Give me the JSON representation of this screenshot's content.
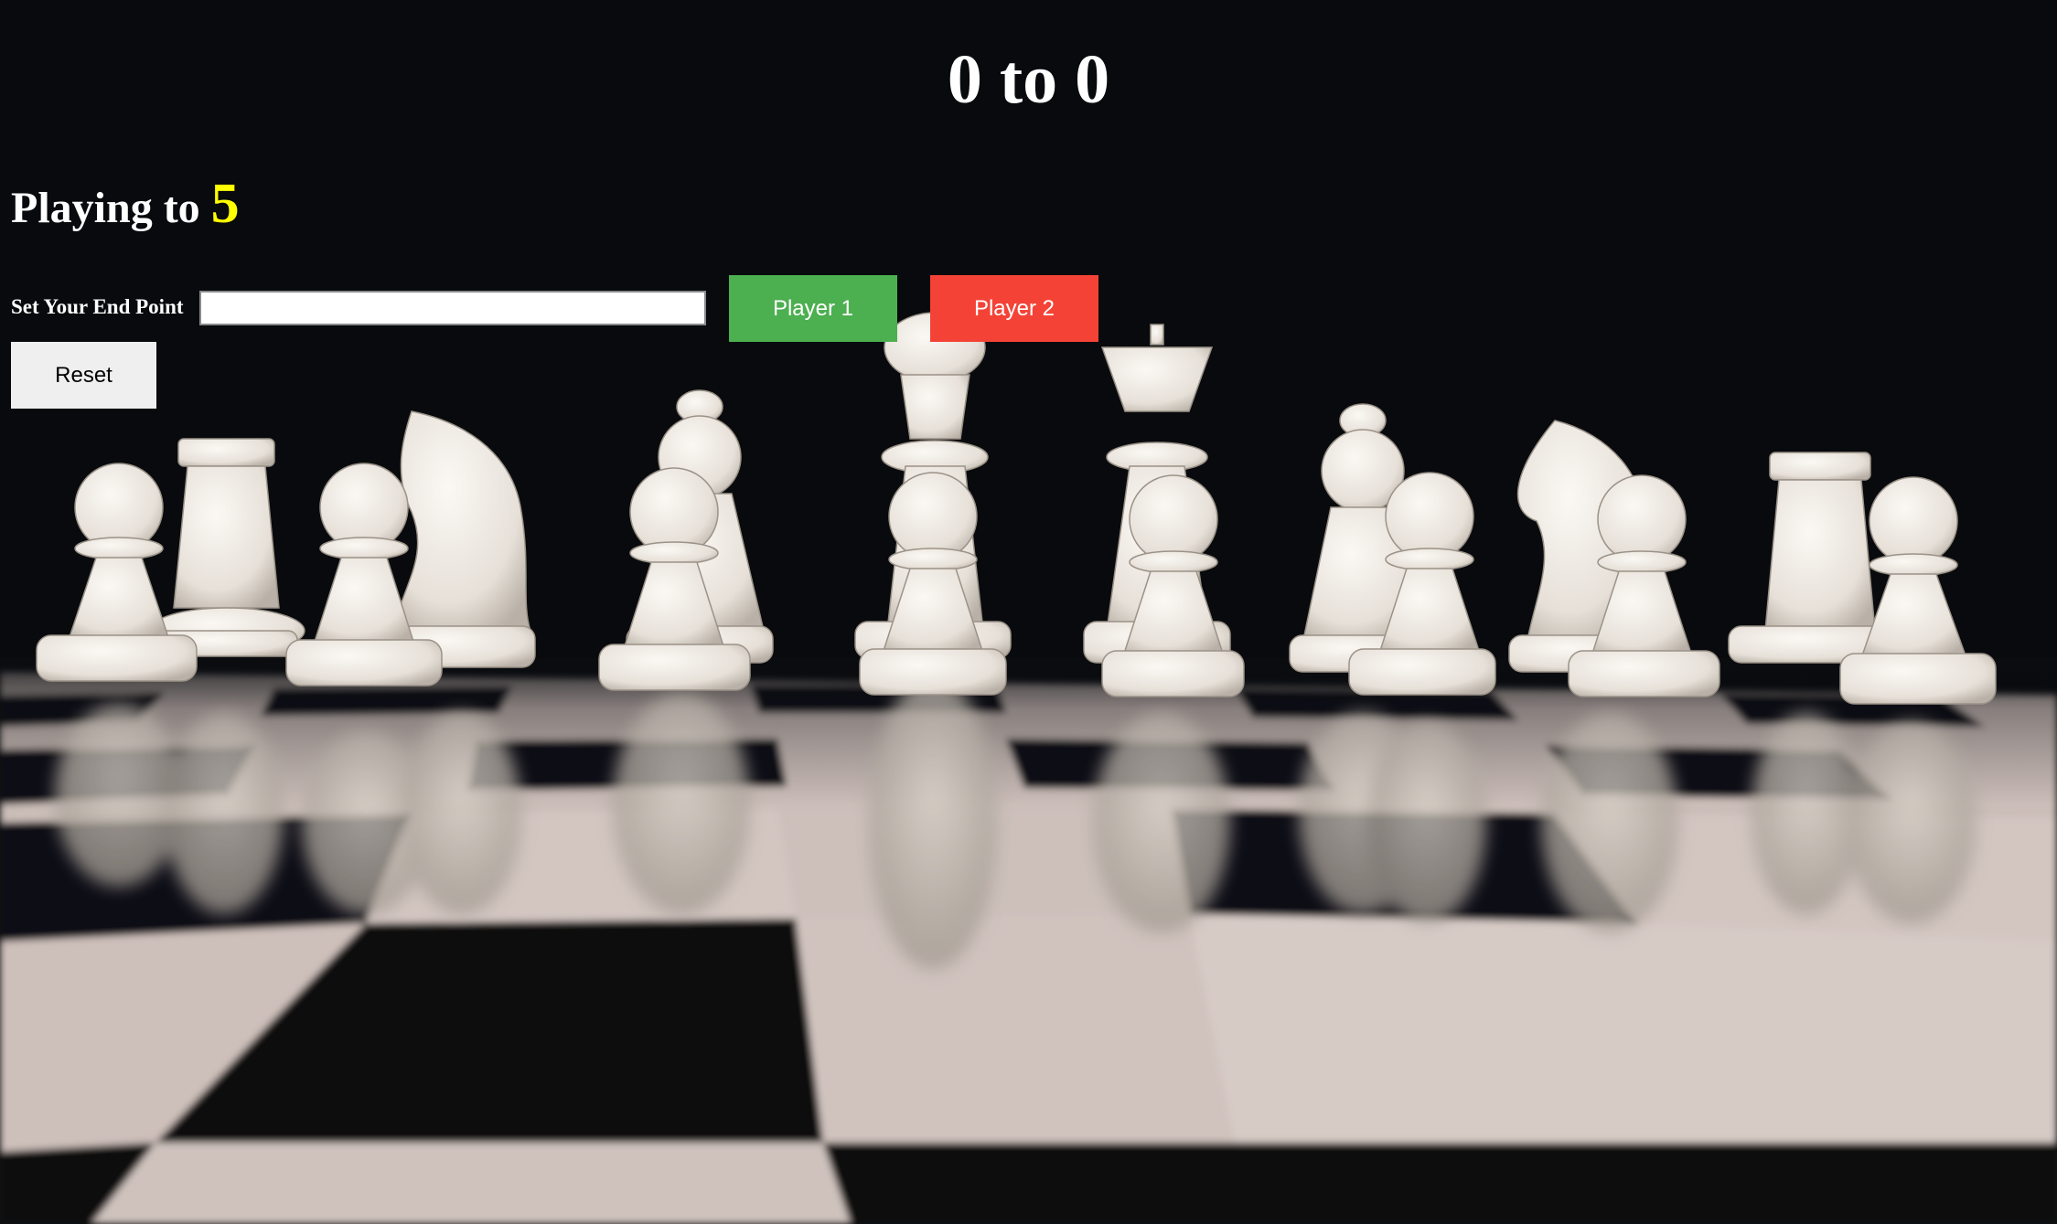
{
  "scoreboard": {
    "player1_score": "0",
    "separator": "to",
    "player2_score": "0"
  },
  "playing_to": {
    "label": "Playing to",
    "value": "5",
    "value_color": "#ffff00"
  },
  "controls": {
    "end_point_label": "Set Your End Point",
    "end_point_value": "",
    "player1_label": "Player 1",
    "player1_color": "#4caf50",
    "player2_label": "Player 2",
    "player2_color": "#f44336",
    "reset_label": "Reset",
    "reset_color": "#efefef"
  },
  "background": {
    "subject": "white chess pieces on a reflective black-and-white checkerboard",
    "base_color": "#080a0d"
  }
}
